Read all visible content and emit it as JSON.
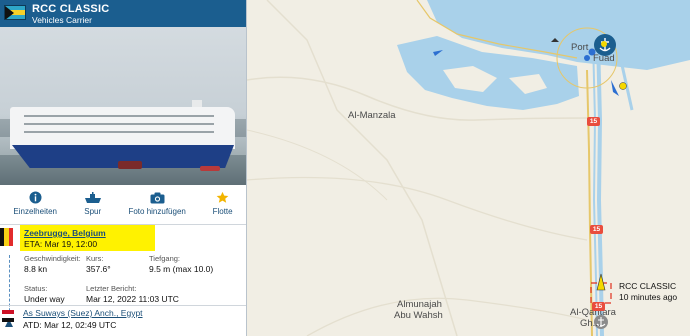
{
  "ship": {
    "name": "RCC CLASSIC",
    "type": "Vehicles Carrier",
    "flag_icon": "bahamas-flag-icon"
  },
  "actions": [
    {
      "label": "Einzelheiten",
      "icon": "info-icon"
    },
    {
      "label": "Spur",
      "icon": "ship-track-icon"
    },
    {
      "label": "Foto hinzufügen",
      "icon": "camera-icon"
    },
    {
      "label": "Flotte",
      "icon": "star-icon"
    }
  ],
  "destination": {
    "port": "Zeebrugge, Belgium",
    "eta": "ETA: Mar 19, 12:00",
    "flag_icon": "belgium-flag-icon",
    "highlight_color": "#fff200"
  },
  "stats": {
    "speed_label": "Geschwindigkeit:",
    "speed_value": "8.8 kn",
    "course_label": "Kurs:",
    "course_value": "357.6°",
    "draught_label": "Tiefgang:",
    "draught_value": "9.5 m (max 10.0)",
    "status_label": "Status:",
    "status_value": "Under way",
    "report_label": "Letzter Bericht:",
    "report_value": "Mar 12, 2022 11:03 UTC"
  },
  "origin": {
    "port": "As Suways (Suez) Anch., Egypt",
    "atd": "ATD: Mar 12, 02:49 UTC",
    "flag_icon": "egypt-flag-icon"
  },
  "map": {
    "labels": {
      "al_manzala": "Al-Manzala",
      "port_fuad_1": "Port",
      "port_fuad_2": "Fuad",
      "almunajah_1": "Almunajah",
      "almunajah_2": "Abu Wahsh",
      "qantara_1": "Al-Qantara",
      "qantara_2": "Gh..."
    },
    "route_badges": [
      "15",
      "15",
      "15"
    ],
    "ship_tooltip": {
      "name": "RCC CLASSIC",
      "time": "10 minutes ago"
    },
    "colors": {
      "land": "#f1eee4",
      "water": "#a9d1ea",
      "road": "#e6c76a",
      "accent": "#1b5e8f",
      "target": "#e0301e"
    }
  }
}
